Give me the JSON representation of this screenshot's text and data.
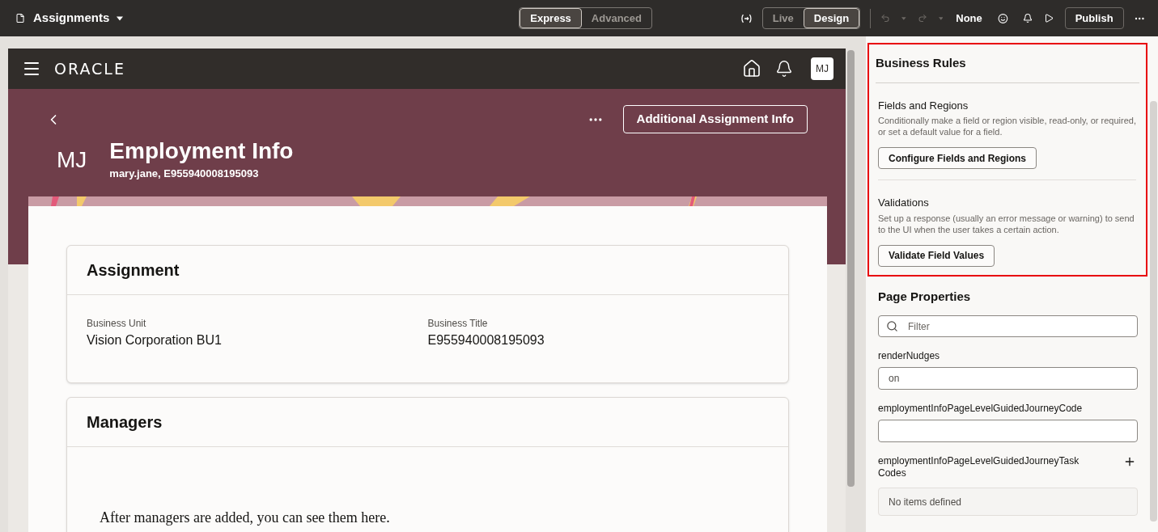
{
  "toolbar": {
    "title": "Assignments",
    "mode_tabs": [
      {
        "label": "Express",
        "selected": true
      },
      {
        "label": "Advanced",
        "selected": false
      }
    ],
    "view_tabs": [
      {
        "label": "Live",
        "selected": false
      },
      {
        "label": "Design",
        "selected": true
      }
    ],
    "undo_disabled": true,
    "redo_disabled": true,
    "target": "None",
    "publish": "Publish"
  },
  "preview": {
    "logo": "ORACLE",
    "user_initials": "MJ",
    "header": {
      "initials": "MJ",
      "title": "Employment Info",
      "subtitle": "mary.jane, E955940008195093",
      "action": "Additional Assignment Info"
    },
    "sections": [
      {
        "title": "Assignment",
        "kind": "fields",
        "fields": [
          {
            "label": "Business Unit",
            "value": "Vision Corporation BU1"
          },
          {
            "label": "Business Title",
            "value": "E955940008195093"
          }
        ]
      },
      {
        "title": "Managers",
        "kind": "empty",
        "message": "After managers are added, you can see them here."
      }
    ]
  },
  "business_rules": {
    "title": "Business Rules",
    "groups": [
      {
        "title": "Fields and Regions",
        "description": "Conditionally make a field or region visible, read-only, or required, or set a default value for a field.",
        "button": "Configure Fields and Regions"
      },
      {
        "title": "Validations",
        "description": "Set up a response (usually an error message or warning) to send to the UI when the user takes a certain action.",
        "button": "Validate Field Values"
      }
    ]
  },
  "page_properties": {
    "title": "Page Properties",
    "filter_placeholder": "Filter",
    "properties": [
      {
        "name": "renderNudges",
        "kind": "text",
        "value": "on"
      },
      {
        "name": "employmentInfoPageLevelGuidedJourneyCode",
        "kind": "text"
      },
      {
        "name": "employmentInfoPageLevelGuidedJourneyTaskCodes",
        "kind": "list",
        "empty_text": "No items defined"
      }
    ]
  }
}
